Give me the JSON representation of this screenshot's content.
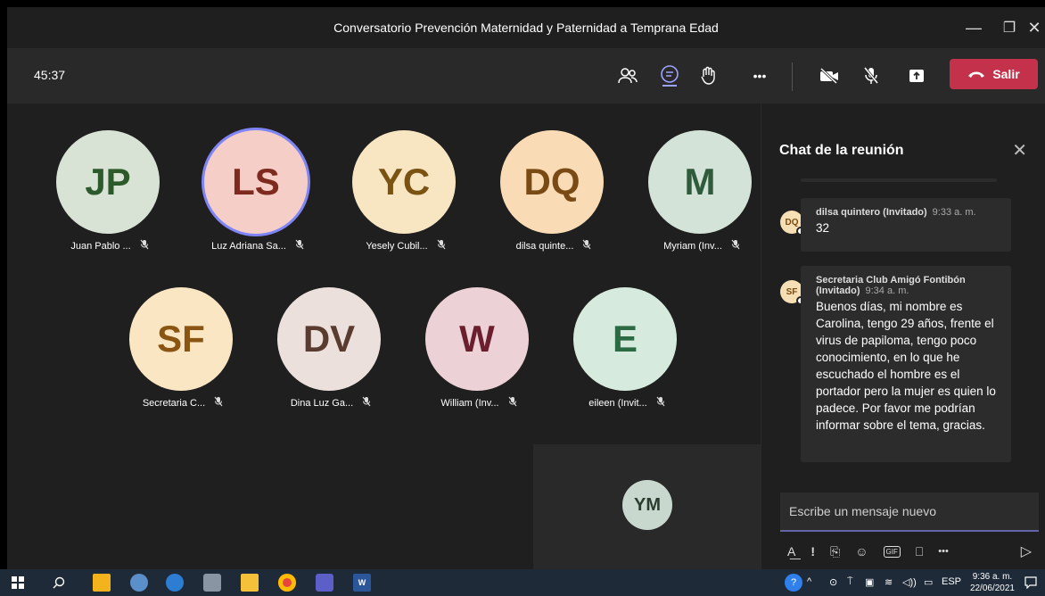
{
  "window": {
    "title": "Conversatorio Prevención Maternidad y Paternidad a Temprana Edad",
    "minimize_glyph": "—",
    "maximize_glyph": "❐",
    "close_glyph": "✕"
  },
  "toolbar": {
    "timer": "45:37",
    "more_glyph": "•••",
    "leave_label": "Salir",
    "leave_color": "#c4314b"
  },
  "participants_row1": [
    {
      "initials": "JP",
      "name": "Juan Pablo ...",
      "bg": "#d8e3d6",
      "fg": "#2d5a2a",
      "speaking": false
    },
    {
      "initials": "LS",
      "name": "Luz Adriana Sa...",
      "bg": "#f5cec7",
      "fg": "#7d2a1f",
      "speaking": true
    },
    {
      "initials": "YC",
      "name": "Yesely Cubil...",
      "bg": "#f8e6c3",
      "fg": "#7a5312",
      "speaking": false
    },
    {
      "initials": "DQ",
      "name": "dilsa quinte...",
      "bg": "#f9dcb5",
      "fg": "#7a4a14",
      "speaking": false
    },
    {
      "initials": "M",
      "name": "Myriam (Inv...",
      "bg": "#d4e3d8",
      "fg": "#2f5b3a",
      "speaking": false
    }
  ],
  "participants_row2": [
    {
      "initials": "SF",
      "name": "Secretaria C...",
      "bg": "#fbe6c3",
      "fg": "#8a5512",
      "speaking": false
    },
    {
      "initials": "DV",
      "name": "Dina Luz Ga...",
      "bg": "#ece0dc",
      "fg": "#5a3b2f",
      "speaking": false
    },
    {
      "initials": "W",
      "name": "William (Inv...",
      "bg": "#ecd1d6",
      "fg": "#6b1f2e",
      "speaking": false
    },
    {
      "initials": "E",
      "name": "eileen (Invit...",
      "bg": "#d6eadd",
      "fg": "#2c6a44",
      "speaking": false
    }
  ],
  "mic_off_glyph": "🎙̸",
  "self_tile": {
    "initials": "YM"
  },
  "chat": {
    "title": "Chat de la reunión",
    "close_glyph": "✕",
    "messages": [
      {
        "avatar": "DQ",
        "sender": "dilsa quintero (Invitado)",
        "time": "9:33 a. m.",
        "text": "32"
      },
      {
        "avatar": "SF",
        "sender": "Secretaria Club Amigó Fontibón (Invitado)",
        "time": "9:34 a. m.",
        "text": "Buenos días, mi nombre es Carolina, tengo 29 años, frente el virus de papiloma, tengo poco conocimiento, en lo que he escuchado el hombre es el portador pero la mujer es quien lo padece. Por favor me podrían informar sobre el tema, gracias."
      }
    ],
    "compose_placeholder": "Escribe un mensaje nuevo",
    "tools": [
      "A͟",
      "!",
      "⎘",
      "☺",
      "GIF",
      "⎕",
      "•••"
    ],
    "send_glyph": "▷"
  },
  "taskbar": {
    "language": "ESP",
    "time": "9:36 a. m.",
    "date": "22/06/2021"
  }
}
